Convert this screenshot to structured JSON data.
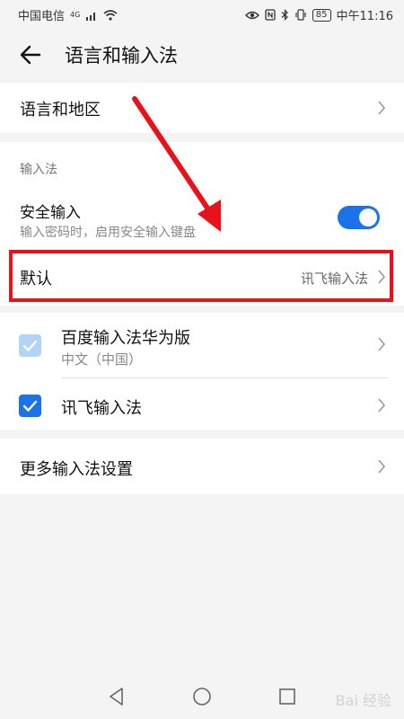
{
  "status_bar": {
    "carrier": "中国电信",
    "network": "4G",
    "battery": "85",
    "time": "中午11:16"
  },
  "header": {
    "title": "语言和输入法"
  },
  "language_region": {
    "label": "语言和地区"
  },
  "input_section": {
    "header": "输入法",
    "secure_input": {
      "title": "安全输入",
      "subtitle": "输入密码时，启用安全输入键盘",
      "enabled": true
    },
    "default": {
      "label": "默认",
      "value": "讯飞输入法"
    }
  },
  "ime_list": [
    {
      "name": "百度输入法华为版",
      "subtitle": "中文（中国）",
      "checked": true,
      "dimmed": true
    },
    {
      "name": "讯飞输入法",
      "checked": true,
      "dimmed": false
    }
  ],
  "more_settings": {
    "label": "更多输入法设置"
  },
  "watermark": {
    "text": "Bai 经验"
  },
  "annotation_color": "#e8121a",
  "accent_color": "#1a73e8"
}
